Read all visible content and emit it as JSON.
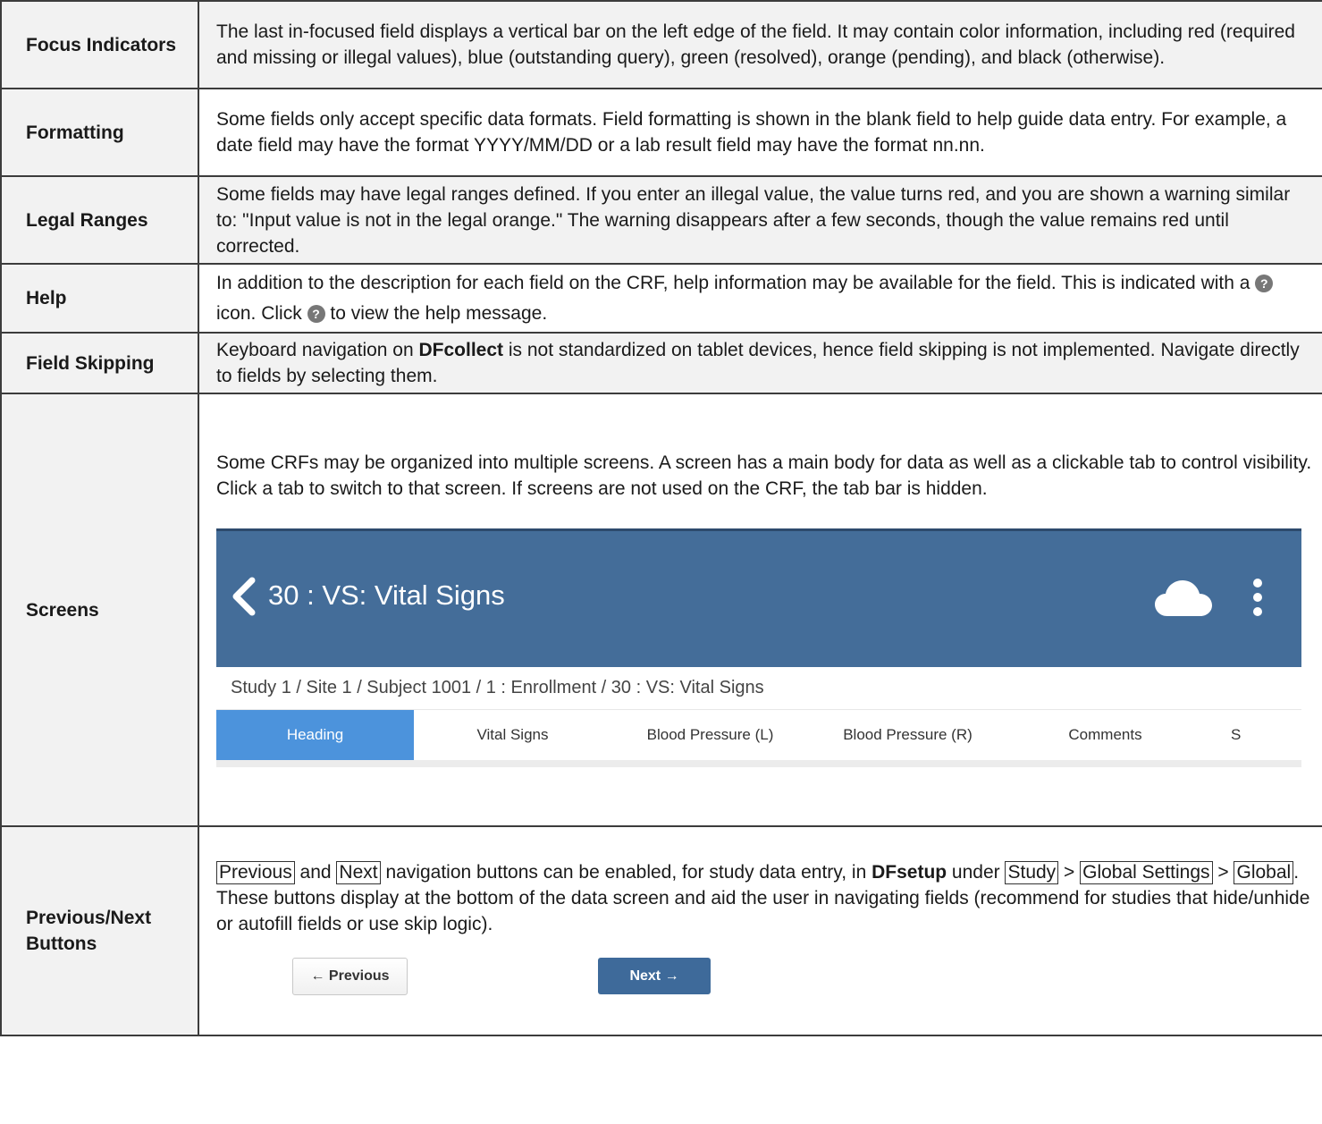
{
  "rows": {
    "focus": {
      "term": "Focus Indicators",
      "desc": "The last in-focused field displays a vertical bar on the left edge of the field. It may contain color information, including red (required and missing or illegal values), blue (outstanding query), green (resolved), orange (pending), and black (otherwise)."
    },
    "formatting": {
      "term": "Formatting",
      "desc": "Some fields only accept specific data formats. Field formatting is shown in the blank field to help guide data entry. For example, a date field may have the format YYYY/MM/DD or a lab result field may have the format nn.nn."
    },
    "legal": {
      "term": "Legal Ranges",
      "desc": "Some fields may have legal ranges defined. If you enter an illegal value, the value turns red, and you are shown a warning similar to: \"Input value is not in the legal orange.\" The warning disappears after a few seconds, though the value remains red until corrected."
    },
    "help": {
      "term": "Help",
      "desc_1": "In addition to the description for each field on the CRF, help information may be available for the field. This is indicated with a ",
      "desc_2": " icon. Click ",
      "desc_3": " to view the help message.",
      "icon": "question-circle-icon"
    },
    "skipping": {
      "term": "Field Skipping",
      "desc_1": "Keyboard navigation on ",
      "desc_bold": "DFcollect",
      "desc_2": " is not standardized on tablet devices, hence field skipping is not implemented. Navigate directly to fields by selecting them."
    },
    "screens": {
      "term": "Screens",
      "desc": "Some CRFs may be organized into multiple screens. A screen has a main body for data as well as a clickable tab to control visibility. Click a tab to switch to that screen. If screens are not used on the CRF, the tab bar is hidden.",
      "shot": {
        "title": "30 : VS: Vital Signs",
        "breadcrumb": "Study 1 / Site 1 / Subject 1001 / 1 : Enrollment / 30 : VS: Vital Signs",
        "tabs": [
          "Heading",
          "Vital Signs",
          "Blood Pressure (L)",
          "Blood Pressure (R)",
          "Comments",
          "S"
        ],
        "active_tab": "Heading",
        "appbar_color": "#446d99",
        "active_tab_color": "#4c93dc"
      }
    },
    "prevnext": {
      "term": "Previous/Next Buttons",
      "kbd_previous": "Previous",
      "t1": " and ",
      "kbd_next": "Next",
      "t2": " navigation buttons can be enabled, for study data entry, in ",
      "bold_dfsetup": "DFsetup",
      "t3": " under ",
      "kbd_study": "Study",
      "t4": " > ",
      "kbd_global_settings": "Global Settings",
      "t5": " > ",
      "kbd_global": "Global",
      "t6": ". These buttons display at the bottom of the data screen and aid the user in navigating fields (recommend for studies that hide/unhide or autofill fields or use skip logic).",
      "shot": {
        "prev_label": "← Previous",
        "next_label": "Next →",
        "next_color": "#3e6a9a"
      }
    }
  }
}
